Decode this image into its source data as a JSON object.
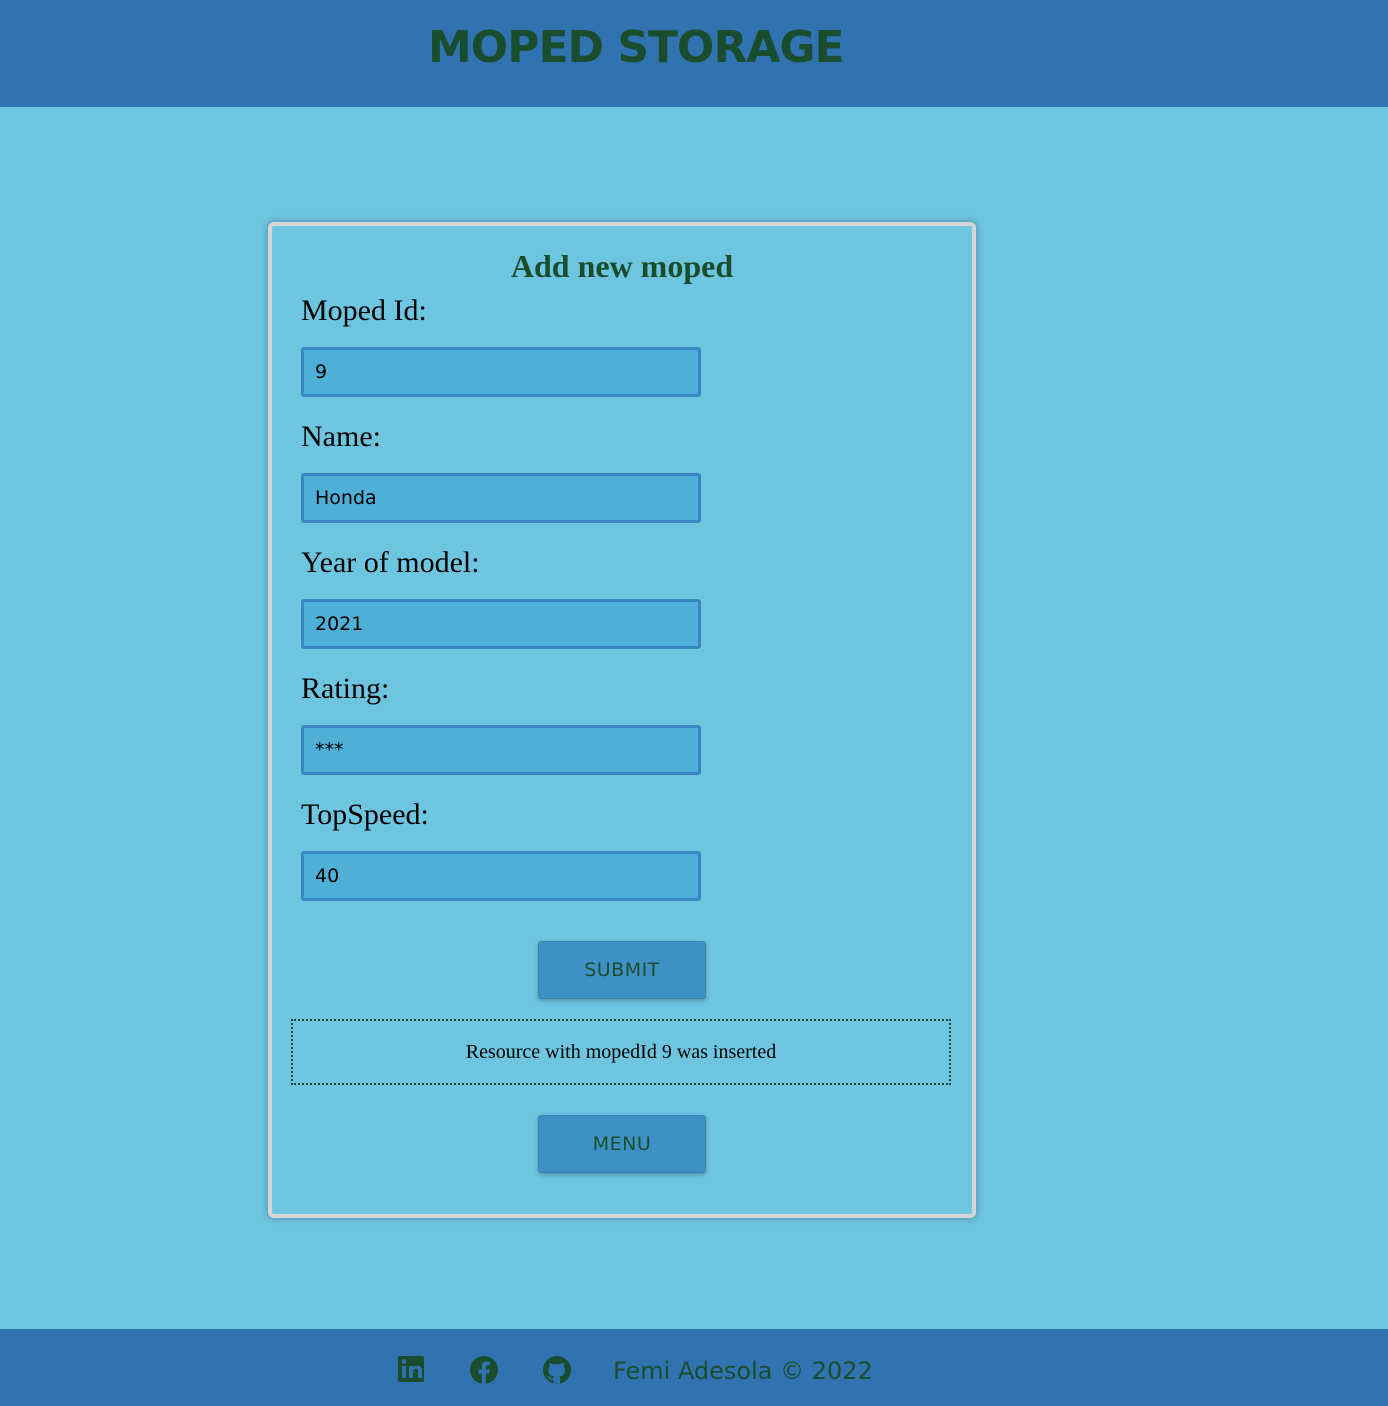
{
  "header": {
    "title": "MOPED STORAGE"
  },
  "form": {
    "title": "Add new moped",
    "fields": [
      {
        "label": "Moped Id:",
        "value": "9"
      },
      {
        "label": "Name:",
        "value": "Honda"
      },
      {
        "label": "Year of model:",
        "value": "2021"
      },
      {
        "label": "Rating:",
        "value": "***"
      },
      {
        "label": "TopSpeed:",
        "value": "40"
      }
    ],
    "submit_label": "SUBMIT",
    "status_message": "Resource with mopedId 9 was inserted",
    "menu_label": "MENU"
  },
  "footer": {
    "icons": [
      "linkedin-icon",
      "facebook-icon",
      "github-icon"
    ],
    "copyright": "Femi Adesola © 2022"
  },
  "colors": {
    "page_background": "#6ec5e0",
    "header_footer": "#3173b1",
    "accent_text": "#1a4d2e",
    "input_background": "#4eb0d6",
    "button_background": "#3e91c5"
  }
}
